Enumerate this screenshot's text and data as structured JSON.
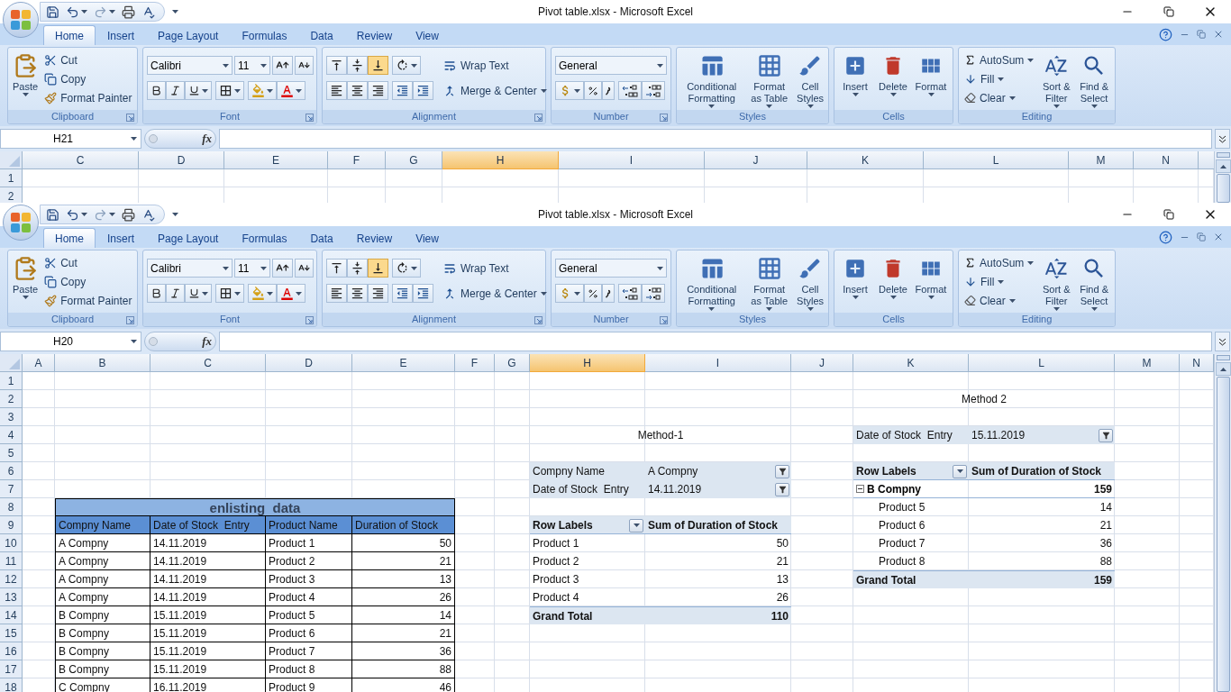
{
  "windows": [
    {
      "title": "Pivot table.xlsx - Microsoft Excel",
      "tabs": [
        {
          "label": "Home",
          "selected": true
        },
        {
          "label": "Insert",
          "selected": false
        },
        {
          "label": "Page Layout",
          "selected": false
        },
        {
          "label": "Formulas",
          "selected": false
        },
        {
          "label": "Data",
          "selected": false
        },
        {
          "label": "Review",
          "selected": false
        },
        {
          "label": "View",
          "selected": false
        }
      ],
      "ribbon": {
        "clipboard": {
          "label": "Clipboard",
          "paste": "Paste",
          "cut": "Cut",
          "copy": "Copy",
          "format_painter": "Format Painter"
        },
        "font": {
          "label": "Font",
          "name": "Calibri",
          "size": "11"
        },
        "alignment": {
          "label": "Alignment",
          "vertical": [
            {
              "kind": "top",
              "selected": false
            },
            {
              "kind": "middle",
              "selected": false
            },
            {
              "kind": "bottom",
              "selected": true
            }
          ],
          "wrap": "Wrap Text",
          "merge": "Merge & Center"
        },
        "number": {
          "label": "Number",
          "format": "General"
        },
        "styles": {
          "label": "Styles",
          "items": [
            "Conditional Formatting",
            "Format as Table",
            "Cell Styles"
          ]
        },
        "cells": {
          "label": "Cells",
          "items": [
            "Insert",
            "Delete",
            "Format"
          ]
        },
        "editing": {
          "label": "Editing",
          "small": [
            "AutoSum",
            "Fill",
            "Clear"
          ],
          "big": [
            "Sort & Filter",
            "Find & Select"
          ]
        }
      },
      "name_box": "H21",
      "function_label": "fx",
      "columns": [
        {
          "label": "C",
          "selected": false
        },
        {
          "label": "D",
          "selected": false
        },
        {
          "label": "E",
          "selected": false
        },
        {
          "label": "F",
          "selected": false
        },
        {
          "label": "G",
          "selected": false
        },
        {
          "label": "H",
          "selected": true
        },
        {
          "label": "I",
          "selected": false
        },
        {
          "label": "J",
          "selected": false
        },
        {
          "label": "K",
          "selected": false
        },
        {
          "label": "L",
          "selected": false
        },
        {
          "label": "M",
          "selected": false
        },
        {
          "label": "N",
          "selected": false
        }
      ],
      "rows": [
        "1",
        "2"
      ]
    },
    {
      "title": "Pivot table.xlsx - Microsoft Excel",
      "tabs": [
        {
          "label": "Home",
          "selected": true
        },
        {
          "label": "Insert",
          "selected": false
        },
        {
          "label": "Page Layout",
          "selected": false
        },
        {
          "label": "Formulas",
          "selected": false
        },
        {
          "label": "Data",
          "selected": false
        },
        {
          "label": "Review",
          "selected": false
        },
        {
          "label": "View",
          "selected": false
        }
      ],
      "ribbon": {
        "clipboard": {
          "label": "Clipboard",
          "paste": "Paste",
          "cut": "Cut",
          "copy": "Copy",
          "format_painter": "Format Painter"
        },
        "font": {
          "label": "Font",
          "name": "Calibri",
          "size": "11"
        },
        "alignment": {
          "label": "Alignment",
          "vertical": [
            {
              "kind": "top",
              "selected": false
            },
            {
              "kind": "middle",
              "selected": false
            },
            {
              "kind": "bottom",
              "selected": true
            }
          ],
          "wrap": "Wrap Text",
          "merge": "Merge & Center"
        },
        "number": {
          "label": "Number",
          "format": "General"
        },
        "styles": {
          "label": "Styles",
          "items": [
            "Conditional Formatting",
            "Format as Table",
            "Cell Styles"
          ]
        },
        "cells": {
          "label": "Cells",
          "items": [
            "Insert",
            "Delete",
            "Format"
          ]
        },
        "editing": {
          "label": "Editing",
          "small": [
            "AutoSum",
            "Fill",
            "Clear"
          ],
          "big": [
            "Sort & Filter",
            "Find & Select"
          ]
        }
      },
      "name_box": "H20",
      "function_label": "fx",
      "columns": [
        {
          "label": "A",
          "selected": false
        },
        {
          "label": "B",
          "selected": false
        },
        {
          "label": "C",
          "selected": false
        },
        {
          "label": "D",
          "selected": false
        },
        {
          "label": "E",
          "selected": false
        },
        {
          "label": "F",
          "selected": false
        },
        {
          "label": "G",
          "selected": false
        },
        {
          "label": "H",
          "selected": true
        },
        {
          "label": "I",
          "selected": false
        },
        {
          "label": "J",
          "selected": false
        },
        {
          "label": "K",
          "selected": false
        },
        {
          "label": "L",
          "selected": false
        },
        {
          "label": "M",
          "selected": false
        },
        {
          "label": "N",
          "selected": false
        }
      ],
      "rows": [
        "1",
        "2",
        "3",
        "4",
        "5",
        "6",
        "7",
        "8",
        "9",
        "10",
        "11",
        "12",
        "13",
        "14",
        "15",
        "16",
        "17",
        "18"
      ],
      "data_table": {
        "title": "enlisting  data",
        "columns": [
          "Compny Name",
          "Date of Stock  Entry",
          "Product Name",
          "Duration of Stock"
        ],
        "rows": [
          [
            "A Compny",
            "14.11.2019",
            "Product 1",
            "50"
          ],
          [
            "A Compny",
            "14.11.2019",
            "Product 2",
            "21"
          ],
          [
            "A Compny",
            "14.11.2019",
            "Product 3",
            "13"
          ],
          [
            "A Compny",
            "14.11.2019",
            "Product 4",
            "26"
          ],
          [
            "B Compny",
            "15.11.2019",
            "Product 5",
            "14"
          ],
          [
            "B Compny",
            "15.11.2019",
            "Product 6",
            "21"
          ],
          [
            "B Compny",
            "15.11.2019",
            "Product 7",
            "36"
          ],
          [
            "B Compny",
            "15.11.2019",
            "Product 8",
            "88"
          ],
          [
            "C Compny",
            "16.11.2019",
            "Product 9",
            "46"
          ]
        ]
      },
      "pivot_1": {
        "heading": "Method-1",
        "filters": [
          {
            "label": "Compny Name",
            "value": "A Compny"
          },
          {
            "label": "Date of Stock  Entry",
            "value": "14.11.2019"
          }
        ],
        "row_labels": "Row Labels",
        "value_header": "Sum of Duration of Stock",
        "rows": [
          {
            "label": "Product 1",
            "value": "50"
          },
          {
            "label": "Product 2",
            "value": "21"
          },
          {
            "label": "Product 3",
            "value": "13"
          },
          {
            "label": "Product 4",
            "value": "26"
          }
        ],
        "total": {
          "label": "Grand Total",
          "value": "110"
        }
      },
      "pivot_2": {
        "heading": "Method 2",
        "filters": [
          {
            "label": "Date of Stock  Entry",
            "value": "15.11.2019"
          }
        ],
        "row_labels": "Row Labels",
        "value_header": "Sum of Duration of Stock",
        "groups": [
          {
            "label": "B Compny",
            "value": "159",
            "expanded": true,
            "children": [
              {
                "label": "Product 5",
                "value": "14"
              },
              {
                "label": "Product 6",
                "value": "21"
              },
              {
                "label": "Product 7",
                "value": "36"
              },
              {
                "label": "Product 8",
                "value": "88"
              }
            ]
          }
        ],
        "total": {
          "label": "Grand Total",
          "value": "159"
        }
      }
    }
  ]
}
